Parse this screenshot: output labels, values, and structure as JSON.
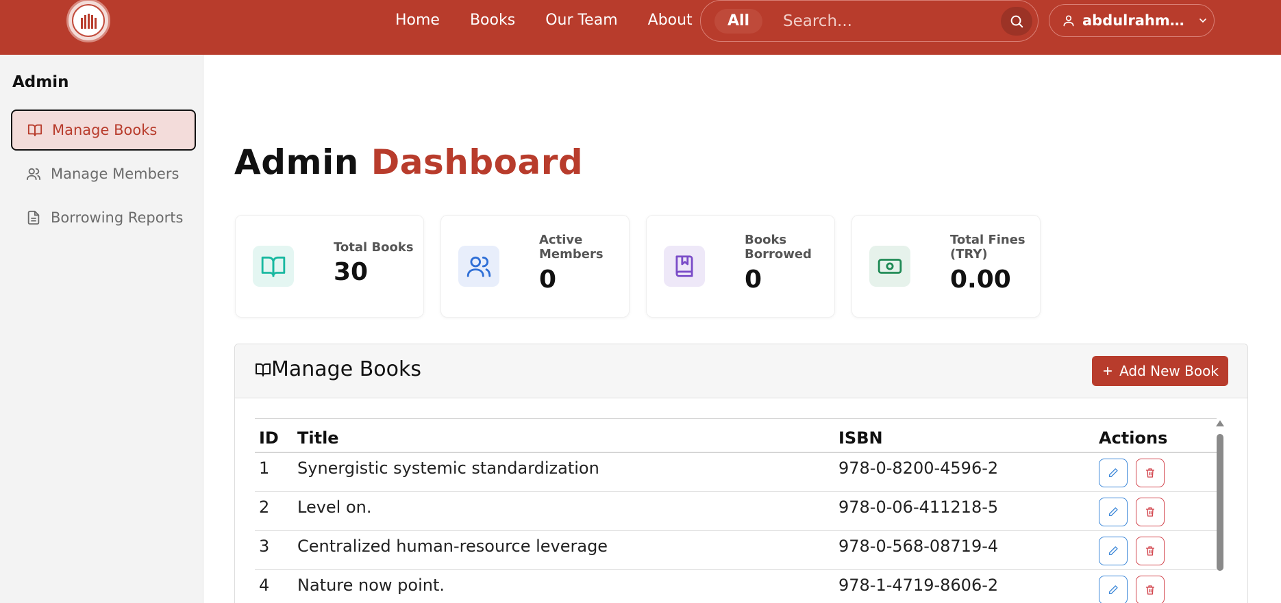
{
  "nav": {
    "links": [
      "Home",
      "Books",
      "Our Team",
      "About"
    ],
    "search_scope": "All",
    "search_placeholder": "Search...",
    "user_name": "abdulrahman"
  },
  "sidebar": {
    "title": "Admin",
    "items": [
      {
        "label": "Manage Books",
        "icon": "book-open-icon",
        "active": true
      },
      {
        "label": "Manage Members",
        "icon": "users-icon",
        "active": false
      },
      {
        "label": "Borrowing Reports",
        "icon": "file-text-icon",
        "active": false
      }
    ]
  },
  "page": {
    "title_prefix": "Admin",
    "title_accent": "Dashboard"
  },
  "stats": [
    {
      "label": "Total Books",
      "value": "30",
      "icon": "book-open-icon",
      "color": "#18b8a0",
      "bg": "#e4f6f2"
    },
    {
      "label": "Active Members",
      "value": "0",
      "icon": "users-icon",
      "color": "#2f6fd6",
      "bg": "#e8eefb"
    },
    {
      "label": "Books Borrowed",
      "value": "0",
      "icon": "book-bookmark-icon",
      "color": "#7a4cc8",
      "bg": "#eee8f8"
    },
    {
      "label": "Total Fines (TRY)",
      "value": "0.00",
      "icon": "banknote-icon",
      "color": "#1f8a55",
      "bg": "#e6f2eb"
    }
  ],
  "books_panel": {
    "title": "Manage Books",
    "add_button": "Add New Book",
    "columns": [
      "ID",
      "Title",
      "ISBN",
      "Actions"
    ],
    "rows": [
      {
        "id": "1",
        "title": "Synergistic systemic standardization",
        "isbn": "978-0-8200-4596-2"
      },
      {
        "id": "2",
        "title": "Level on.",
        "isbn": "978-0-06-411218-5"
      },
      {
        "id": "3",
        "title": "Centralized human-resource leverage",
        "isbn": "978-0-568-08719-4"
      },
      {
        "id": "4",
        "title": "Nature now point.",
        "isbn": "978-1-4719-8606-2"
      }
    ]
  },
  "colors": {
    "brand": "#b83c2c",
    "edit": "#3a86d8",
    "delete": "#d2444c"
  }
}
